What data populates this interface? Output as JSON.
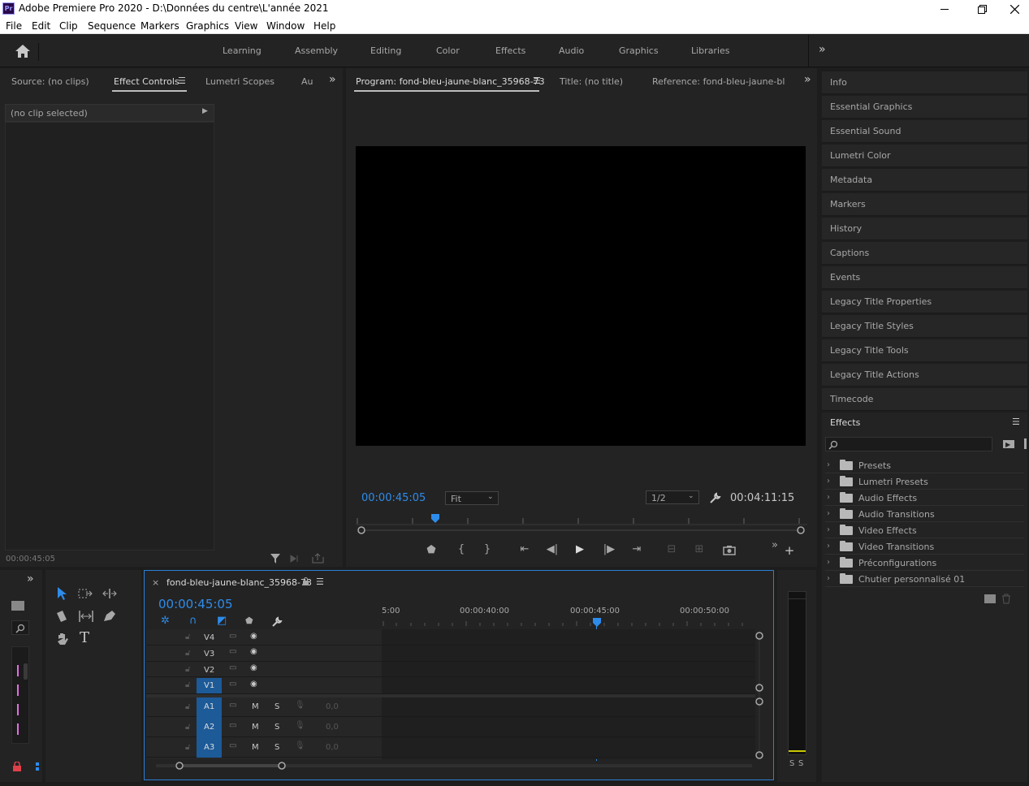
{
  "window": {
    "title": "Adobe Premiere Pro 2020 - D:\\Données du centre\\L'année 2021",
    "logo": "Pr"
  },
  "menu": [
    "File",
    "Edit",
    "Clip",
    "Sequence",
    "Markers",
    "Graphics",
    "View",
    "Window",
    "Help"
  ],
  "workspaces": [
    "Learning",
    "Assembly",
    "Editing",
    "Color",
    "Effects",
    "Audio",
    "Graphics",
    "Libraries"
  ],
  "source_panel": {
    "tabs": [
      "Source: (no clips)",
      "Effect Controls",
      "Lumetri Scopes",
      "Au"
    ],
    "no_clip": "(no clip selected)",
    "timecode": "00:00:45:05"
  },
  "program_panel": {
    "tabs": [
      "Program: fond-bleu-jaune-blanc_35968-73",
      "Title: (no title)",
      "Reference: fond-bleu-jaune-blanc"
    ],
    "timecode": "00:00:45:05",
    "fit": "Fit",
    "resolution": "1/2",
    "duration": "00:04:11:15"
  },
  "right_panel": {
    "items": [
      "Info",
      "Essential Graphics",
      "Essential Sound",
      "Lumetri Color",
      "Metadata",
      "Markers",
      "History",
      "Captions",
      "Events",
      "Legacy Title Properties",
      "Legacy Title Styles",
      "Legacy Title Tools",
      "Legacy Title Actions",
      "Timecode"
    ]
  },
  "effects_panel": {
    "title": "Effects",
    "items": [
      "Presets",
      "Lumetri Presets",
      "Audio Effects",
      "Audio Transitions",
      "Video Effects",
      "Video Transitions",
      "Préconfigurations",
      "Chutier personnalisé 01"
    ]
  },
  "timeline": {
    "close": "×",
    "name": "fond-bleu-jaune-blanc_35968-73",
    "timecode": "00:00:45:05",
    "ruler": [
      "5:00",
      "00:00:40:00",
      "00:00:45:00",
      "00:00:50:00"
    ],
    "video_tracks": [
      "V4",
      "V3",
      "V2",
      "V1"
    ],
    "audio_tracks": [
      "A1",
      "A2",
      "A3"
    ],
    "m": "M",
    "s": "S",
    "vol": "0,0"
  },
  "meter": {
    "s1": "S",
    "s2": "S"
  }
}
